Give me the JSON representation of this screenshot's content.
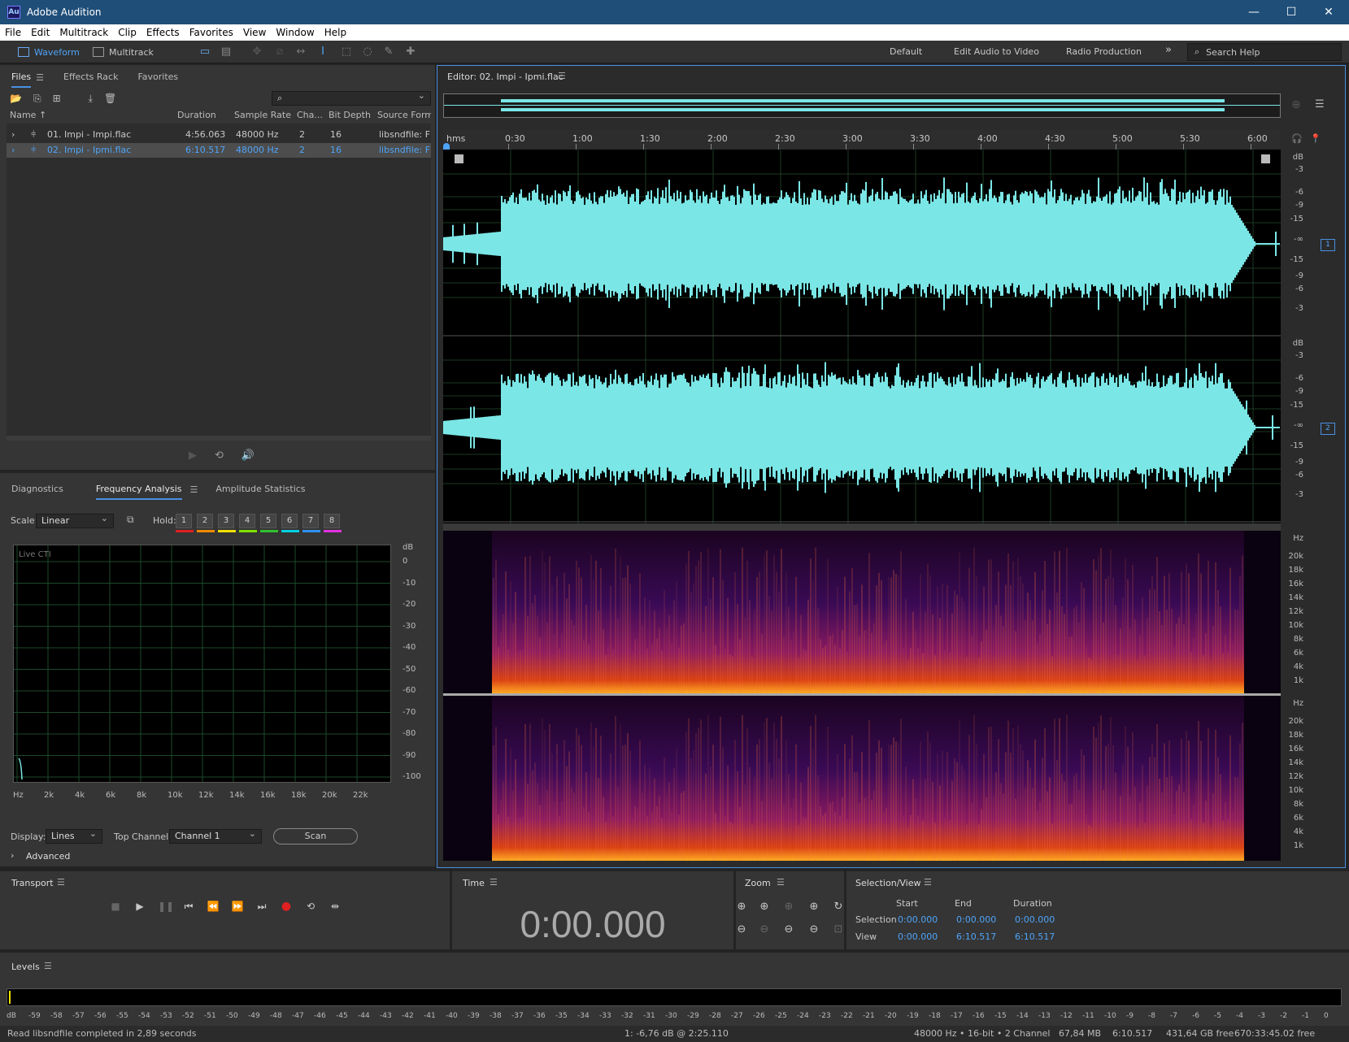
{
  "app": {
    "title": "Adobe Audition",
    "logo": "Au"
  },
  "window_controls": {
    "minimize": "—",
    "maximize": "☐",
    "close": "✕"
  },
  "menu": [
    "File",
    "Edit",
    "Multitrack",
    "Clip",
    "Effects",
    "Favorites",
    "View",
    "Window",
    "Help"
  ],
  "toolbar": {
    "waveform": "Waveform",
    "multitrack": "Multitrack",
    "workspaces": [
      "Default",
      "Edit Audio to Video",
      "Radio Production"
    ],
    "more": "»",
    "search_help": "Search Help"
  },
  "files_panel": {
    "tabs": [
      "Files",
      "Effects Rack",
      "Favorites"
    ],
    "columns": [
      "Name ↑",
      "Duration",
      "Sample Rate",
      "Cha...",
      "Bit Depth",
      "Source Form..."
    ],
    "rows": [
      {
        "name": "01. Impi - Impi.flac",
        "duration": "4:56.063",
        "rate": "48000 Hz",
        "ch": "2",
        "bits": "16",
        "source": "libsndfile: FL"
      },
      {
        "name": "02. Impi - Ipmi.flac",
        "duration": "6:10.517",
        "rate": "48000 Hz",
        "ch": "2",
        "bits": "16",
        "source": "libsndfile: FL"
      }
    ]
  },
  "analysis_panel": {
    "tabs": [
      "Diagnostics",
      "Frequency Analysis",
      "Amplitude Statistics"
    ],
    "scale_label": "Scale:",
    "scale_value": "Linear",
    "hold_label": "Hold:",
    "hold_buttons": [
      "1",
      "2",
      "3",
      "4",
      "5",
      "6",
      "7",
      "8"
    ],
    "hold_colors": [
      "#e02020",
      "#f08a00",
      "#f0e000",
      "#80e000",
      "#30c030",
      "#00d0e0",
      "#3090f0",
      "#e030e0"
    ],
    "graph_label": "Live CTI",
    "db_unit": "dB",
    "db_ticks": [
      "0",
      "-10",
      "-20",
      "-30",
      "-40",
      "-50",
      "-60",
      "-70",
      "-80",
      "-90",
      "-100"
    ],
    "hz_ticks": [
      "Hz",
      "2k",
      "4k",
      "6k",
      "8k",
      "10k",
      "12k",
      "14k",
      "16k",
      "18k",
      "20k",
      "22k"
    ],
    "display_label": "Display:",
    "display_value": "Lines",
    "top_channel_label": "Top Channel:",
    "top_channel_value": "Channel 1",
    "scan_button": "Scan",
    "advanced": "Advanced"
  },
  "editor": {
    "title": "Editor: 02. Impi - Ipmi.flac",
    "ruler_unit": "hms",
    "ruler_ticks": [
      "0:30",
      "1:00",
      "1:30",
      "2:00",
      "2:30",
      "3:00",
      "3:30",
      "4:00",
      "4:30",
      "5:00",
      "5:30",
      "6:00"
    ],
    "db_unit": "dB",
    "db_ticks": [
      "-3",
      "-6",
      "-9",
      "-15",
      "-∞",
      "-15",
      "-9",
      "-6",
      "-3"
    ],
    "hz_unit": "Hz",
    "hz_ticks": [
      "20k",
      "18k",
      "16k",
      "14k",
      "12k",
      "10k",
      "8k",
      "6k",
      "4k",
      "1k"
    ],
    "channels": [
      "1",
      "2"
    ],
    "waveform_color": "#7be6e6"
  },
  "transport": {
    "title": "Transport"
  },
  "time": {
    "title": "Time",
    "value": "0:00.000"
  },
  "zoom": {
    "title": "Zoom"
  },
  "selection_view": {
    "title": "Selection/View",
    "headers": [
      "Start",
      "End",
      "Duration"
    ],
    "selection_label": "Selection",
    "view_label": "View",
    "selection": [
      "0:00.000",
      "0:00.000",
      "0:00.000"
    ],
    "view": [
      "0:00.000",
      "6:10.517",
      "6:10.517"
    ]
  },
  "levels": {
    "title": "Levels",
    "ticks": [
      "dB",
      "-59",
      "-58",
      "-57",
      "-56",
      "-55",
      "-54",
      "-53",
      "-52",
      "-51",
      "-50",
      "-49",
      "-48",
      "-47",
      "-46",
      "-45",
      "-44",
      "-43",
      "-42",
      "-41",
      "-40",
      "-39",
      "-38",
      "-37",
      "-36",
      "-35",
      "-34",
      "-33",
      "-32",
      "-31",
      "-30",
      "-29",
      "-28",
      "-27",
      "-26",
      "-25",
      "-24",
      "-23",
      "-22",
      "-21",
      "-20",
      "-19",
      "-18",
      "-17",
      "-16",
      "-15",
      "-14",
      "-13",
      "-12",
      "-11",
      "-10",
      "-9",
      "-8",
      "-7",
      "-6",
      "-5",
      "-4",
      "-3",
      "-2",
      "-1",
      "0"
    ]
  },
  "status": {
    "message": "Read libsndfile completed in 2,89 seconds",
    "cursor": "1: -6,76 dB @ 2:25.110",
    "format": "48000 Hz • 16-bit • 2 Channel",
    "size": "67,84 MB",
    "duration": "6:10.517",
    "free": "431,64 GB free",
    "free_time": "670:33:45.02 free"
  }
}
